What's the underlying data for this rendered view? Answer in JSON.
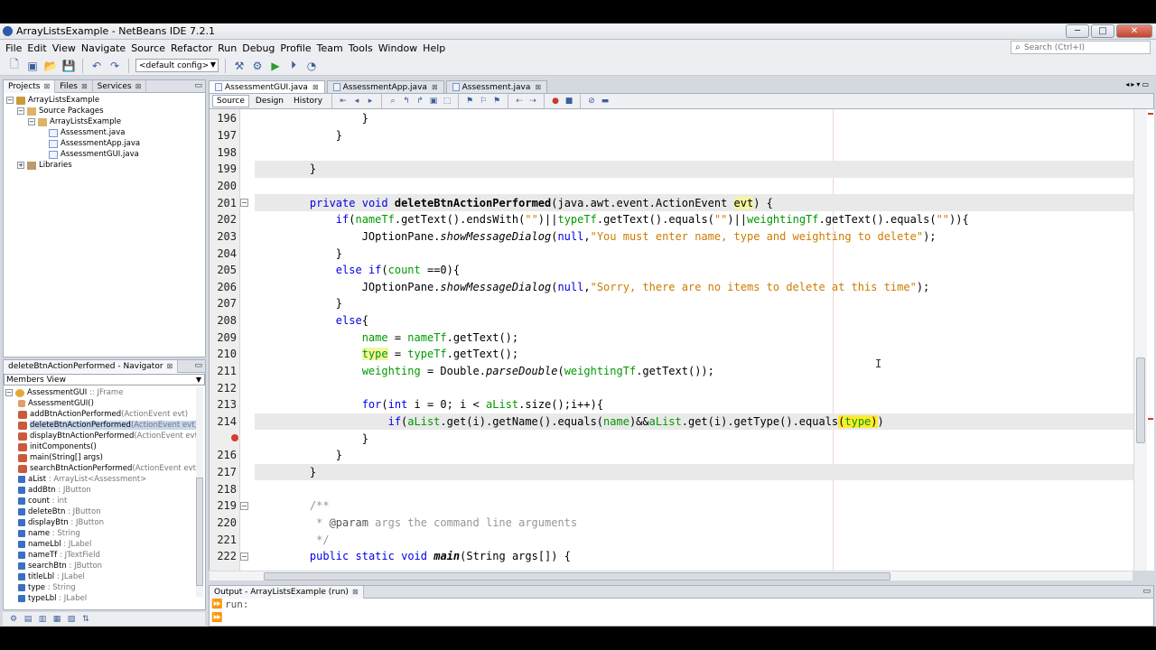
{
  "window": {
    "title": "ArrayListsExample - NetBeans IDE 7.2.1",
    "buttons": [
      "─",
      "□",
      "✕"
    ]
  },
  "menus": [
    "File",
    "Edit",
    "View",
    "Navigate",
    "Source",
    "Refactor",
    "Run",
    "Debug",
    "Profile",
    "Team",
    "Tools",
    "Window",
    "Help"
  ],
  "search": {
    "placeholder": "Search (Ctrl+I)"
  },
  "toolbar": {
    "config": "<default config>"
  },
  "projects_panel": {
    "tabs": [
      "Projects",
      "Files",
      "Services"
    ],
    "tree": [
      {
        "label": "ArrayListsExample",
        "indent": 0,
        "toggle": "−",
        "icon": "proj"
      },
      {
        "label": "Source Packages",
        "indent": 1,
        "toggle": "−",
        "icon": "pkg"
      },
      {
        "label": "ArrayListsExample",
        "indent": 2,
        "toggle": "−",
        "icon": "pkg"
      },
      {
        "label": "Assessment.java",
        "indent": 3,
        "toggle": "",
        "icon": "java"
      },
      {
        "label": "AssessmentApp.java",
        "indent": 3,
        "toggle": "",
        "icon": "java"
      },
      {
        "label": "AssessmentGUI.java",
        "indent": 3,
        "toggle": "",
        "icon": "java"
      },
      {
        "label": "Libraries",
        "indent": 1,
        "toggle": "+",
        "icon": "lib"
      }
    ]
  },
  "navigator": {
    "title": "deleteBtnActionPerformed - Navigator",
    "view": "Members View",
    "items": [
      {
        "name": "AssessmentGUI",
        "type": " :: JFrame",
        "indent": 0,
        "icon": "cls",
        "toggle": "−"
      },
      {
        "name": "AssessmentGUI()",
        "type": "",
        "indent": 1,
        "icon": "meth2"
      },
      {
        "name": "addBtnActionPerformed",
        "type": "(ActionEvent evt)",
        "indent": 1,
        "icon": "meth"
      },
      {
        "name": "deleteBtnActionPerformed",
        "type": "(ActionEvent evt)",
        "indent": 1,
        "icon": "meth",
        "selected": true
      },
      {
        "name": "displayBtnActionPerformed",
        "type": "(ActionEvent evt)",
        "indent": 1,
        "icon": "meth"
      },
      {
        "name": "initComponents()",
        "type": "",
        "indent": 1,
        "icon": "meth"
      },
      {
        "name": "main(String[] args)",
        "type": "",
        "indent": 1,
        "icon": "meth"
      },
      {
        "name": "searchBtnActionPerformed",
        "type": "(ActionEvent evt)",
        "indent": 1,
        "icon": "meth"
      },
      {
        "name": "aList",
        "type": " : ArrayList<Assessment>",
        "indent": 1,
        "icon": "fld"
      },
      {
        "name": "addBtn",
        "type": " : JButton",
        "indent": 1,
        "icon": "fld"
      },
      {
        "name": "count",
        "type": " : int",
        "indent": 1,
        "icon": "fld"
      },
      {
        "name": "deleteBtn",
        "type": " : JButton",
        "indent": 1,
        "icon": "fld"
      },
      {
        "name": "displayBtn",
        "type": " : JButton",
        "indent": 1,
        "icon": "fld"
      },
      {
        "name": "name",
        "type": " : String",
        "indent": 1,
        "icon": "fld"
      },
      {
        "name": "nameLbl",
        "type": " : JLabel",
        "indent": 1,
        "icon": "fld"
      },
      {
        "name": "nameTf",
        "type": " : JTextField",
        "indent": 1,
        "icon": "fld"
      },
      {
        "name": "searchBtn",
        "type": " : JButton",
        "indent": 1,
        "icon": "fld"
      },
      {
        "name": "titleLbl",
        "type": " : JLabel",
        "indent": 1,
        "icon": "fld"
      },
      {
        "name": "type",
        "type": " : String",
        "indent": 1,
        "icon": "fld"
      },
      {
        "name": "typeLbl",
        "type": " : JLabel",
        "indent": 1,
        "icon": "fld"
      },
      {
        "name": "typeTf",
        "type": " : JTextField",
        "indent": 1,
        "icon": "fld"
      }
    ]
  },
  "editor": {
    "tabs": [
      {
        "label": "AssessmentGUI.java",
        "active": true
      },
      {
        "label": "AssessmentApp.java",
        "active": false
      },
      {
        "label": "Assessment.java",
        "active": false
      }
    ],
    "views": [
      "Source",
      "Design",
      "History"
    ],
    "lines": [
      {
        "n": "196",
        "html": "            }"
      },
      {
        "n": "197",
        "html": "        }"
      },
      {
        "n": "198",
        "html": ""
      },
      {
        "n": "199",
        "html": "    }",
        "hl": true
      },
      {
        "n": "200",
        "html": ""
      },
      {
        "n": "201",
        "html": "    <span class=\"kw\">private</span> <span class=\"kw\">void</span> <span class=\"boldc\">deleteBtnActionPerformed</span>(java.awt.event.ActionEvent <span class=\"occ\">evt</span>) {",
        "hl": true,
        "fold": true
      },
      {
        "n": "202",
        "html": "        <span class=\"kw\">if</span>(<span class=\"fieldc\">nameTf</span>.getText().endsWith(<span class=\"str\">\"\"</span>)||<span class=\"fieldc\">typeTf</span>.getText().equals(<span class=\"str\">\"\"</span>)||<span class=\"fieldc\">weightingTf</span>.getText().equals(<span class=\"str\">\"\"</span>)){"
      },
      {
        "n": "203",
        "html": "            JOptionPane.<span class=\"ital\">showMessageDialog</span>(<span class=\"kw\">null</span>,<span class=\"str\">\"You must enter name, type and weighting to delete\"</span>);"
      },
      {
        "n": "204",
        "html": "        }"
      },
      {
        "n": "205",
        "html": "        <span class=\"kw\">else</span> <span class=\"kw\">if</span>(<span class=\"fieldc\">count</span> ==0){"
      },
      {
        "n": "206",
        "html": "            JOptionPane.<span class=\"ital\">showMessageDialog</span>(<span class=\"kw\">null</span>,<span class=\"str\">\"Sorry, there are no items to delete at this time\"</span>);"
      },
      {
        "n": "207",
        "html": "        }"
      },
      {
        "n": "208",
        "html": "        <span class=\"kw\">else</span>{"
      },
      {
        "n": "209",
        "html": "            <span class=\"fieldc\">name</span> = <span class=\"fieldc\">nameTf</span>.getText();"
      },
      {
        "n": "210",
        "html": "            <span class=\"fieldc occ\">type</span> = <span class=\"fieldc\">typeTf</span>.getText();"
      },
      {
        "n": "211",
        "html": "            <span class=\"fieldc\">weighting</span> = Double.<span class=\"ital\">parseDouble</span>(<span class=\"fieldc\">weightingTf</span>.getText());"
      },
      {
        "n": "212",
        "html": ""
      },
      {
        "n": "213",
        "html": "            <span class=\"kw\">for</span>(<span class=\"kw\">int</span> i = 0; i &lt; <span class=\"fieldc\">aList</span>.size();i++){"
      },
      {
        "n": "214",
        "html": "                <span class=\"kw\">if</span>(<span class=\"fieldc\">aList</span>.get(i).getName().equals(<span class=\"fieldc\">name</span>)&amp;&amp;<span class=\"fieldc\">aList</span>.get(i).getType().equals<span class=\"yel\">(<span class=\"fieldc\">type</span>)</span>)",
        "hl": true
      },
      {
        "n": "",
        "html": "            }",
        "bp": true
      },
      {
        "n": "216",
        "html": "        }"
      },
      {
        "n": "217",
        "html": "    }",
        "hl": true
      },
      {
        "n": "218",
        "html": ""
      },
      {
        "n": "219",
        "html": "    <span class=\"cmt\">/**</span>",
        "fold": true
      },
      {
        "n": "220",
        "html": "<span class=\"cmt\">     * <span style=\"color:#555\">@param</span> args the command line arguments</span>"
      },
      {
        "n": "221",
        "html": "<span class=\"cmt\">     */</span>"
      },
      {
        "n": "222",
        "html": "    <span class=\"kw\">public</span> <span class=\"kw\">static</span> <span class=\"kw\">void</span> <span class=\"boldc ital\">main</span>(String args[]) {",
        "fold": true
      }
    ]
  },
  "output": {
    "title": "Output - ArrayListsExample (run)",
    "text": "run:"
  }
}
